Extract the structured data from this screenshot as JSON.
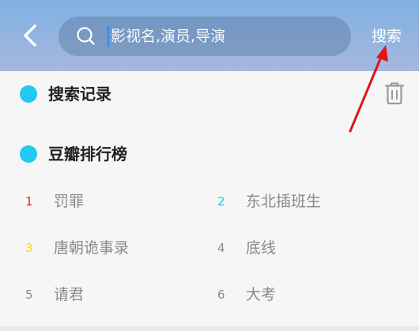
{
  "header": {
    "search_placeholder": "影视名,演员,导演",
    "search_button": "搜索",
    "colors": {
      "bar_top": "#7fb1e3",
      "bar_bottom": "#a6b7dd",
      "arrow": "#e0141b"
    }
  },
  "history": {
    "title": "搜索记录",
    "dot_color": "#22c8f0"
  },
  "ranking": {
    "title": "豆瓣排行榜",
    "dot_color": "#22c8f0",
    "items": [
      {
        "rank": "1",
        "title": "罚罪",
        "rank_color": "#e8232a"
      },
      {
        "rank": "2",
        "title": "东北插班生",
        "rank_color": "#2bc3d8"
      },
      {
        "rank": "3",
        "title": "唐朝诡事录",
        "rank_color": "#f3d81a"
      },
      {
        "rank": "4",
        "title": "底线",
        "rank_color": "#8a8a8a"
      },
      {
        "rank": "5",
        "title": "请君",
        "rank_color": "#8a8a8a"
      },
      {
        "rank": "6",
        "title": "大考",
        "rank_color": "#8a8a8a"
      }
    ]
  }
}
